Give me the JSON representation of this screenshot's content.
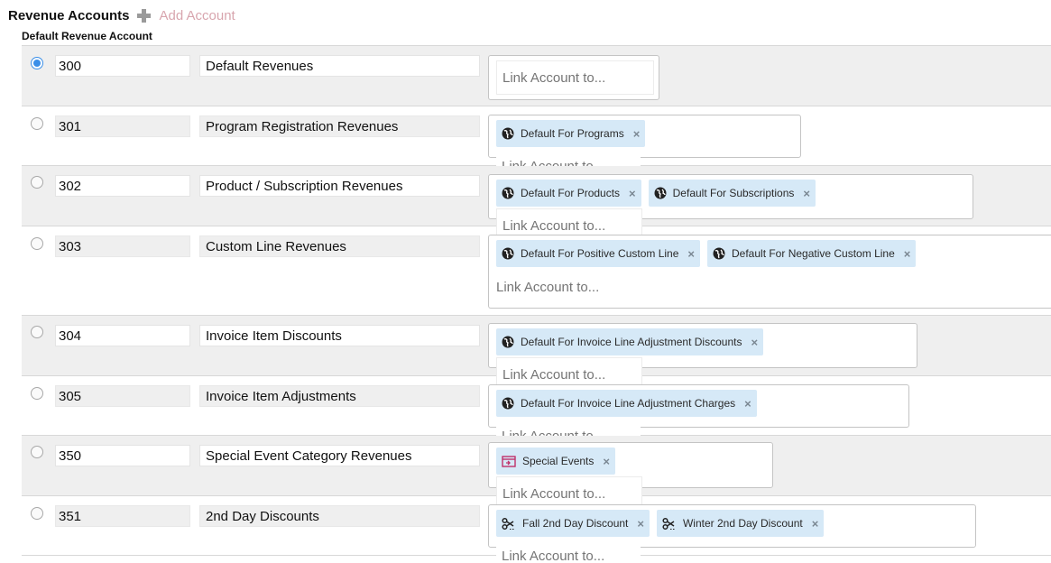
{
  "header": {
    "title": "Revenue Accounts",
    "add_label": "Add Account"
  },
  "subtitle": "Default Revenue Account",
  "link_placeholder": "Link Account to...",
  "colors": {
    "radio_selected": "#3b8fe8",
    "tag_bg": "#d6e9f7",
    "add_label": "#d8a5ae",
    "event_icon": "#c0306a"
  },
  "accounts": [
    {
      "number": "300",
      "name": "Default Revenues",
      "selected": true,
      "tags": []
    },
    {
      "number": "301",
      "name": "Program Registration Revenues",
      "selected": false,
      "tags": [
        {
          "icon": "globe-icon",
          "label": "Default For Programs"
        }
      ]
    },
    {
      "number": "302",
      "name": "Product / Subscription Revenues",
      "selected": false,
      "tags": [
        {
          "icon": "globe-icon",
          "label": "Default For Products"
        },
        {
          "icon": "globe-icon",
          "label": "Default For Subscriptions"
        }
      ]
    },
    {
      "number": "303",
      "name": "Custom Line Revenues",
      "selected": false,
      "tags": [
        {
          "icon": "globe-icon",
          "label": "Default For Positive Custom Line"
        },
        {
          "icon": "globe-icon",
          "label": "Default For Negative Custom Line"
        }
      ]
    },
    {
      "number": "304",
      "name": "Invoice Item Discounts",
      "selected": false,
      "tags": [
        {
          "icon": "globe-icon",
          "label": "Default For Invoice Line Adjustment Discounts"
        }
      ]
    },
    {
      "number": "305",
      "name": "Invoice Item Adjustments",
      "selected": false,
      "tags": [
        {
          "icon": "globe-icon",
          "label": "Default For Invoice Line Adjustment Charges"
        }
      ]
    },
    {
      "number": "350",
      "name": "Special Event Category Revenues",
      "selected": false,
      "tags": [
        {
          "icon": "event-icon",
          "label": "Special Events"
        }
      ]
    },
    {
      "number": "351",
      "name": "2nd Day Discounts",
      "selected": false,
      "tags": [
        {
          "icon": "scissors-icon",
          "label": "Fall 2nd Day Discount"
        },
        {
          "icon": "scissors-icon",
          "label": "Winter 2nd Day Discount"
        }
      ]
    }
  ]
}
